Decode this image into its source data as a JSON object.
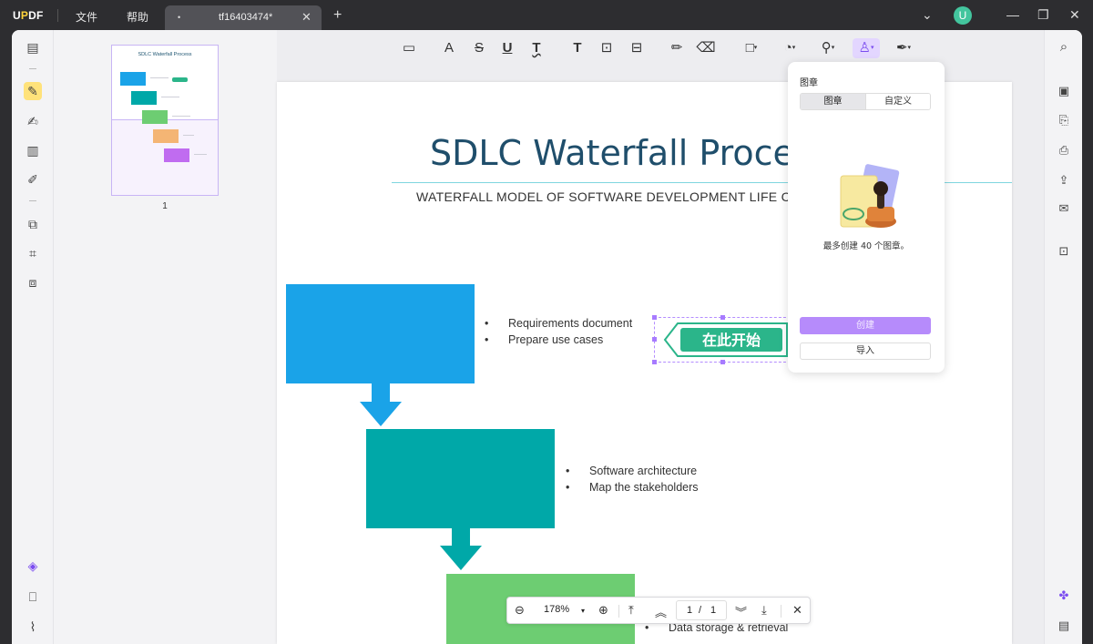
{
  "app": {
    "logo_u": "U",
    "logo_p": "P",
    "logo_df": "DF",
    "menu": [
      "文件",
      "帮助"
    ],
    "tab": {
      "dot": "•",
      "title": "tf16403474*",
      "close": "✕"
    },
    "tab_add": "+",
    "avatar": "U",
    "window_controls": {
      "dropdown": "⌄",
      "minimize": "—",
      "restore": "❐",
      "close": "✕"
    }
  },
  "colors": {
    "accent": "#b68bfb",
    "blue_box": "#1aa3e8",
    "teal_box": "#00a8a8",
    "green_box": "#6dcd72",
    "stamp_green": "#2bb58a"
  },
  "left_tools": [
    {
      "icon": "reader-icon",
      "glyph": "▤"
    },
    {
      "icon": "highlight-comment-icon",
      "glyph": "✎",
      "active": true
    },
    {
      "icon": "edit-pdf-icon",
      "glyph": "✍"
    },
    {
      "icon": "page-layout-icon",
      "glyph": "▥"
    },
    {
      "icon": "form-icon",
      "glyph": "✐"
    },
    {
      "icon": "organize-pages-icon",
      "glyph": "⧉"
    },
    {
      "icon": "crop-icon",
      "glyph": "⌗"
    },
    {
      "icon": "compress-icon",
      "glyph": "⧈"
    },
    {
      "icon": "layers-icon",
      "glyph": "◈"
    },
    {
      "icon": "bookmark-icon",
      "glyph": "⎕"
    },
    {
      "icon": "attachment-icon",
      "glyph": "⌇"
    }
  ],
  "thumbnail": {
    "title": "SDLC Waterfall Process",
    "page_number": "1"
  },
  "toolbar": [
    {
      "icon": "note-icon",
      "glyph": "▭"
    },
    {
      "icon": "highlight-icon",
      "glyph": "A"
    },
    {
      "icon": "strikethrough-icon",
      "glyph": "S"
    },
    {
      "icon": "underline-icon",
      "glyph": "U"
    },
    {
      "icon": "squiggly-icon",
      "glyph": "T"
    },
    {
      "icon": "text-icon",
      "glyph": "T"
    },
    {
      "icon": "textbox-icon",
      "glyph": "⊡"
    },
    {
      "icon": "text-callout-icon",
      "glyph": "⊟"
    },
    {
      "icon": "pencil-icon",
      "glyph": "✏"
    },
    {
      "icon": "eraser-icon",
      "glyph": "⌫"
    },
    {
      "icon": "shape-icon",
      "glyph": "□",
      "caret": "▾"
    },
    {
      "icon": "sticker-icon",
      "glyph": "◔",
      "caret": "▾"
    },
    {
      "icon": "pin-icon",
      "glyph": "⚲",
      "caret": "▾"
    },
    {
      "icon": "stamp-icon",
      "glyph": "♙",
      "caret": "▾",
      "active": true
    },
    {
      "icon": "signature-icon",
      "glyph": "✒",
      "caret": "▾"
    }
  ],
  "document": {
    "title": "SDLC Waterfall Process",
    "subtitle": "WATERFALL MODEL OF SOFTWARE DEVELOPMENT LIFE CYCLE",
    "step1_bullets": [
      "Requirements document",
      "Prepare use cases"
    ],
    "step2_bullets": [
      "Software architecture",
      "Map the stakeholders"
    ],
    "step3_bullets": [
      "Data storage & retrieval"
    ],
    "stamp_text": "在此开始"
  },
  "stamp_panel": {
    "title": "图章",
    "tabs": [
      "图章",
      "自定义"
    ],
    "note": "最多创建 40 个图章。",
    "create_label": "创建",
    "import_label": "导入"
  },
  "zoombar": {
    "zoom_out": "⊖",
    "zoom_value": "178%",
    "zoom_caret": "▾",
    "zoom_in": "⊕",
    "first_page": "⤒",
    "prev_page": "︽",
    "current_page": "1",
    "page_sep": "/",
    "total_pages": "1",
    "next_page": "︾",
    "last_page": "⤓",
    "close": "✕"
  },
  "right_tools": [
    {
      "icon": "search-icon",
      "glyph": "⌕"
    },
    {
      "icon": "ocr-icon",
      "glyph": "▣"
    },
    {
      "icon": "convert-icon",
      "glyph": "⎘"
    },
    {
      "icon": "protect-icon",
      "glyph": "⎙"
    },
    {
      "icon": "share-icon",
      "glyph": "⇪"
    },
    {
      "icon": "email-icon",
      "glyph": "✉"
    },
    {
      "icon": "save-icon",
      "glyph": "⊡"
    },
    {
      "icon": "ai-assistant-icon",
      "glyph": "✤"
    },
    {
      "icon": "comments-icon",
      "glyph": "▤"
    }
  ]
}
